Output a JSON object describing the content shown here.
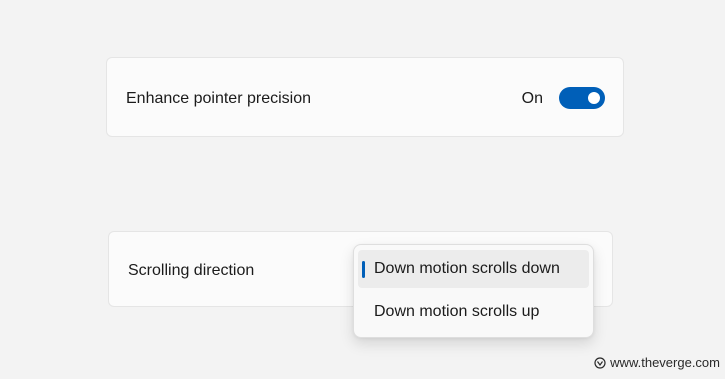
{
  "pointer_setting": {
    "label": "Enhance pointer precision",
    "state_text": "On",
    "enabled": true
  },
  "scroll_setting": {
    "label": "Scrolling direction",
    "options": [
      {
        "label": "Down motion scrolls down",
        "selected": true
      },
      {
        "label": "Down motion scrolls up",
        "selected": false
      }
    ]
  },
  "watermark": {
    "text": "www.theverge.com"
  },
  "colors": {
    "background": "#f3f3f3",
    "card": "#fbfbfb",
    "accent": "#005fb8",
    "selected_option_bg": "#ececec"
  },
  "icons": {
    "watermark_logo": "verge-logo-icon"
  }
}
